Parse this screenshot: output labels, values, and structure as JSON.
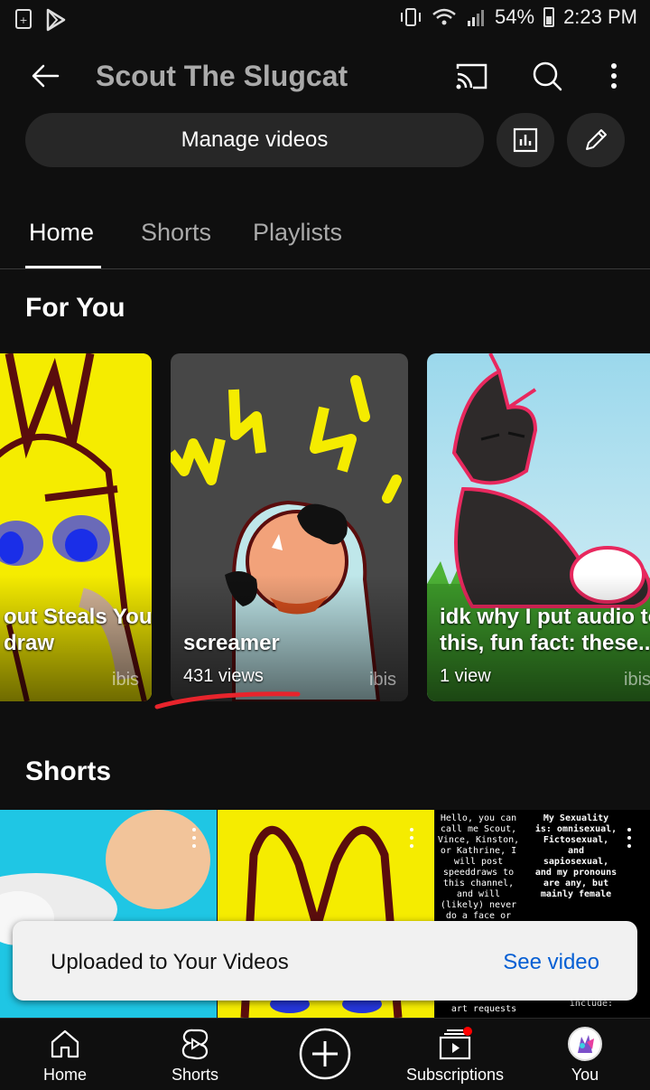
{
  "status_bar": {
    "battery": "54%",
    "time": "2:23 PM"
  },
  "header": {
    "title": "Scout The Slugcat",
    "manage_label": "Manage videos"
  },
  "tabs": [
    {
      "label": "Home",
      "active": true
    },
    {
      "label": "Shorts",
      "active": false
    },
    {
      "label": "Playlists",
      "active": false
    }
  ],
  "for_you": {
    "heading": "For You",
    "cards": [
      {
        "title_line1": "out Steals You",
        "title_line2": "draw",
        "watermark": "ibis"
      },
      {
        "title_line1": "screamer",
        "views": "431 views",
        "watermark": "ibis"
      },
      {
        "title_line1": "idk why I put audio to",
        "title_line2": "this, fun fact: these...",
        "views": "1 view",
        "watermark": "ibis"
      }
    ]
  },
  "shorts": {
    "heading": "Shorts",
    "text_thumb": {
      "left_block": "Hello, you can\ncall me Scout,\nVince, Kinston,\nor Kathrine, I\nwill post\nspeeddraws to\nthis channel,\nand will\n(likely) never\ndo a face or\nvoice reveal",
      "right_block": "My Sexuality\nis: omnisexual,\nFictosexual,\nand\nsapiosexual,\nand my pronouns\nare any, but\nmainly female",
      "bottom_left": "art requests",
      "bottom_right": "include:"
    }
  },
  "toast": {
    "message": "Uploaded to Your Videos",
    "action": "See video"
  },
  "bottom_nav": [
    {
      "label": "Home",
      "icon": "home-icon"
    },
    {
      "label": "Shorts",
      "icon": "shorts-icon"
    },
    {
      "label": "",
      "icon": "create-icon"
    },
    {
      "label": "Subscriptions",
      "icon": "subscriptions-icon"
    },
    {
      "label": "You",
      "icon": "avatar"
    }
  ],
  "colors": {
    "background": "#0f0f0f",
    "chip": "#272727",
    "link": "#065fd4",
    "notification": "#ff0000"
  }
}
